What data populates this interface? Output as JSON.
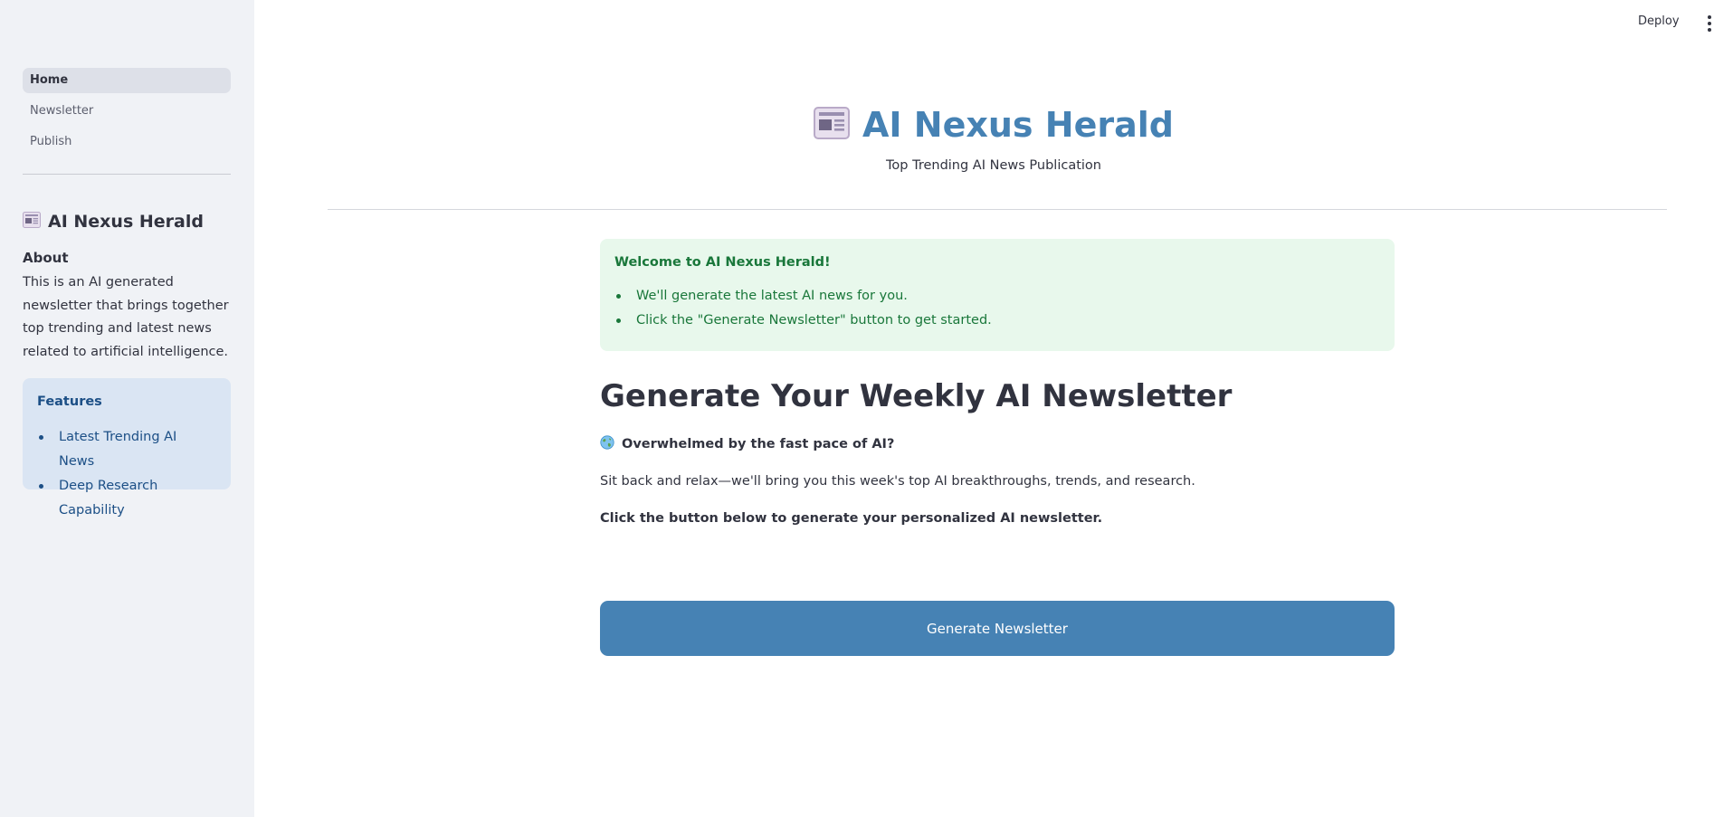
{
  "header": {
    "deploy_label": "Deploy"
  },
  "sidebar": {
    "nav": [
      {
        "label": "Home",
        "active": true
      },
      {
        "label": "Newsletter",
        "active": false
      },
      {
        "label": "Publish",
        "active": false
      }
    ],
    "title": "AI Nexus Herald",
    "title_icon": "newspaper-icon",
    "about_heading": "About",
    "about_text": "This is an AI generated newsletter that brings together top trending and latest news related to artificial intelligence.",
    "features": {
      "heading": "Features",
      "items": [
        "Latest Trending AI News",
        "Deep Research Capability"
      ]
    }
  },
  "main": {
    "title": "AI Nexus Herald",
    "title_icon": "newspaper-icon",
    "subtitle": "Top Trending AI News Publication",
    "welcome": {
      "heading": "Welcome to AI Nexus Herald!",
      "items": [
        "We'll generate the latest AI news for you.",
        "Click the \"Generate Newsletter\" button to get started."
      ]
    },
    "section_heading": "Generate Your Weekly AI Newsletter",
    "overwhelm_icon": "globe-icon",
    "overwhelm_text": "Overwhelmed by the fast pace of AI?",
    "relax_text": "Sit back and relax—we'll bring you this week's top AI breakthroughs, trends, and research.",
    "click_text": "Click the button below to generate your personalized AI newsletter.",
    "button_label": "Generate Newsletter"
  },
  "colors": {
    "accent": "#4682b4",
    "sidebar_bg": "#f0f2f6",
    "success_bg": "#e8f8ec",
    "success_text": "#19773a",
    "info_bg": "#dae5f3",
    "info_text": "#1c4f86"
  }
}
